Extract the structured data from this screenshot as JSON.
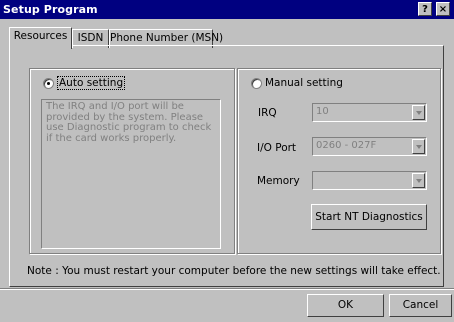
{
  "window": {
    "title": "Setup Program",
    "help_glyph": "?",
    "close_glyph": "×"
  },
  "tabs": [
    {
      "label": "Resources",
      "active": true
    },
    {
      "label": "ISDN",
      "active": false
    },
    {
      "label": "Phone Number (MSN)",
      "active": false
    }
  ],
  "auto": {
    "label": "Auto setting",
    "selected": true,
    "info": "The IRQ and I/O port will be provided by the system.  Please use Diagnostic program to check if the card works properly."
  },
  "manual": {
    "label": "Manual setting",
    "selected": false,
    "irq": {
      "label": "IRQ",
      "value": "10"
    },
    "io_port": {
      "label": "I/O Port",
      "value": "0260 - 027F"
    },
    "memory": {
      "label": "Memory",
      "value": ""
    },
    "diagnostics_button": "Start NT Diagnostics"
  },
  "note": "Note : You must restart your computer before the new settings will take effect.",
  "buttons": {
    "ok": "OK",
    "cancel": "Cancel"
  },
  "colors": {
    "titlebar": "#000080",
    "face": "#c0c0c0",
    "disabled_text": "#808080"
  }
}
